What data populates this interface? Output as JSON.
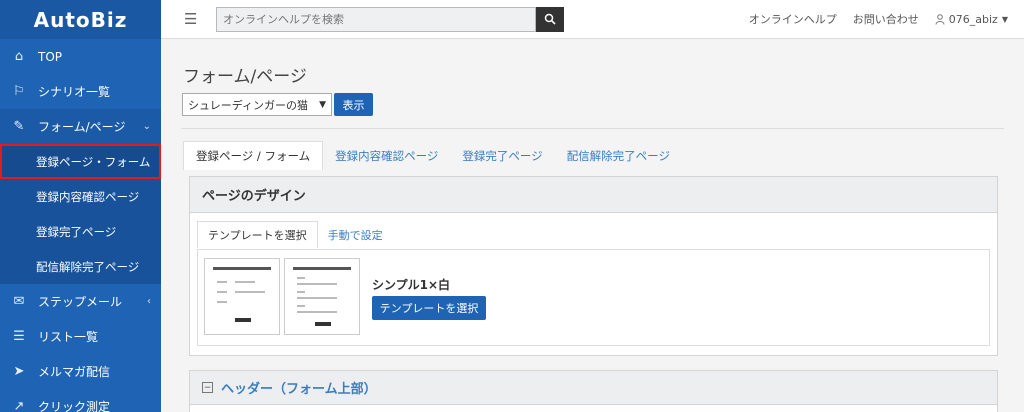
{
  "brand": {
    "logo": "AutoBiz"
  },
  "sidebar": {
    "items": [
      {
        "label": "TOP",
        "icon": "home-icon"
      },
      {
        "label": "シナリオ一覧",
        "icon": "flag-icon"
      },
      {
        "label": "フォーム/ページ",
        "icon": "pencil-icon",
        "caret": "⌄"
      },
      {
        "label": "ステップメール",
        "icon": "envelope-icon",
        "caret": "‹"
      },
      {
        "label": "リスト一覧",
        "icon": "list-icon"
      },
      {
        "label": "メルマガ配信",
        "icon": "send-icon"
      },
      {
        "label": "クリック測定",
        "icon": "chart-icon"
      }
    ],
    "subitems": [
      {
        "label": "登録ページ・フォーム",
        "active": true
      },
      {
        "label": "登録内容確認ページ"
      },
      {
        "label": "登録完了ページ"
      },
      {
        "label": "配信解除完了ページ"
      }
    ]
  },
  "topbar": {
    "search_placeholder": "オンラインヘルプを検索",
    "help_link": "オンラインヘルプ",
    "contact_link": "お問い合わせ",
    "user_name": "076_abiz"
  },
  "main": {
    "title": "フォーム/ページ",
    "select_value": "シュレーディンガーの猫",
    "show_button": "表示",
    "tabs": [
      {
        "label": "登録ページ / フォーム",
        "active": true
      },
      {
        "label": "登録内容確認ページ"
      },
      {
        "label": "登録完了ページ"
      },
      {
        "label": "配信解除完了ページ"
      }
    ],
    "design_panel": {
      "heading": "ページのデザイン",
      "subtabs": [
        {
          "label": "テンプレートを選択",
          "active": true
        },
        {
          "label": "手動で設定"
        }
      ],
      "template_name": "シンプル1×白",
      "template_button": "テンプレートを選択"
    },
    "header_panel": {
      "heading": "ヘッダー（フォーム上部）"
    }
  }
}
